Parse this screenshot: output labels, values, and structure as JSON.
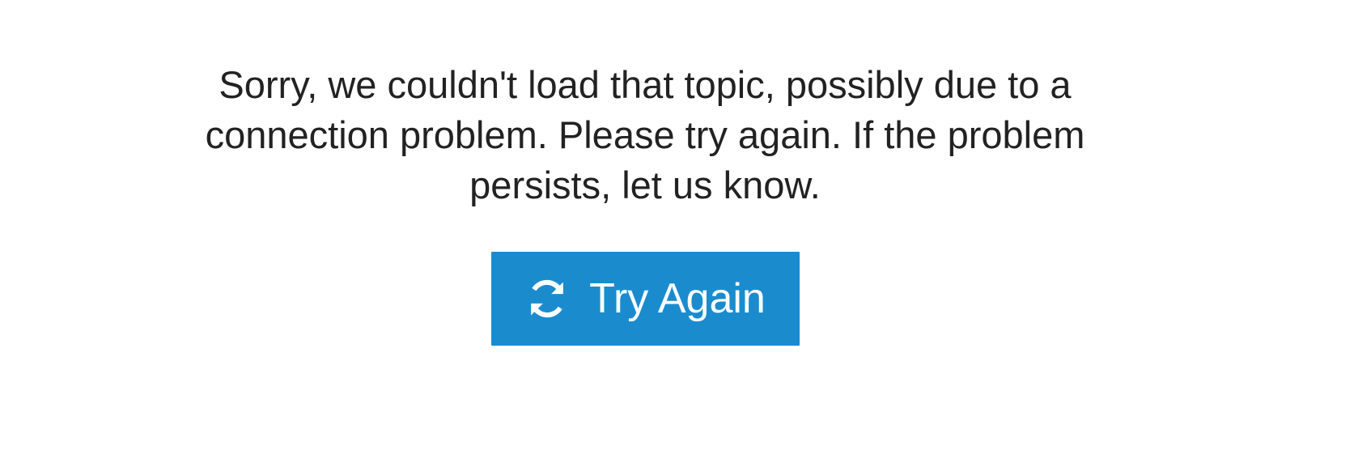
{
  "error": {
    "message": "Sorry, we couldn't load that topic, possibly due to a connection problem. Please try again. If the problem persists, let us know."
  },
  "retry_button": {
    "label": "Try Again",
    "icon": "refresh-icon"
  },
  "colors": {
    "background": "#ffffff",
    "text": "#222222",
    "button_bg": "#1a8cce",
    "button_text": "#ffffff"
  }
}
